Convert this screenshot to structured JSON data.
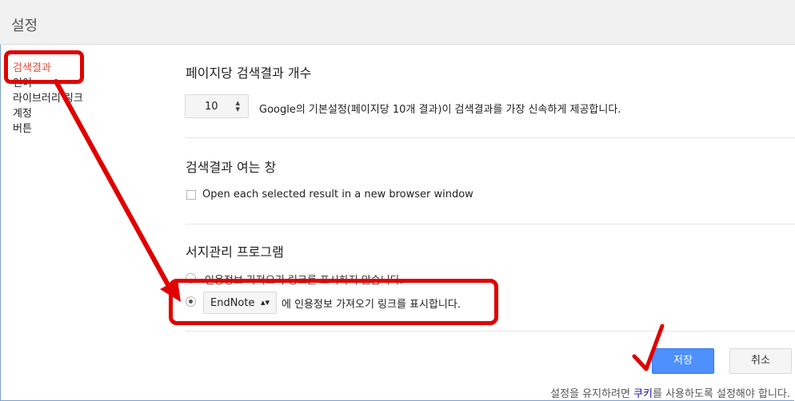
{
  "header": {
    "title": "설정"
  },
  "sidebar": {
    "items": [
      {
        "label": "검색결과"
      },
      {
        "label": "언어"
      },
      {
        "label": "라이브러리 링크"
      },
      {
        "label": "계정"
      },
      {
        "label": "버튼"
      }
    ]
  },
  "results_per_page": {
    "title": "페이지당 검색결과 개수",
    "value": "10",
    "description": "Google의 기본설정(페이지당 10개 결과)이 검색결과를 가장 신속하게 제공합니다."
  },
  "result_window": {
    "title": "검색결과 여는 창",
    "checkbox_label": "Open each selected result in a new browser window"
  },
  "bibliography": {
    "title": "서지관리 프로그램",
    "option_none": "인용정보 가져오기 링크를 표시하지 않습니다.",
    "selected_manager": "EndNote",
    "option_show_suffix": "에 인용정보 가져오기 링크를 표시합니다."
  },
  "buttons": {
    "save": "저장",
    "cancel": "취소"
  },
  "footer": {
    "prefix": "설정을 유지하려면 ",
    "link": "쿠키",
    "suffix": "를 사용하도록 설정해야 합니다."
  },
  "colors": {
    "accent": "#4d90fe",
    "active_nav": "#dd4b39",
    "annotation": "#e00000"
  }
}
